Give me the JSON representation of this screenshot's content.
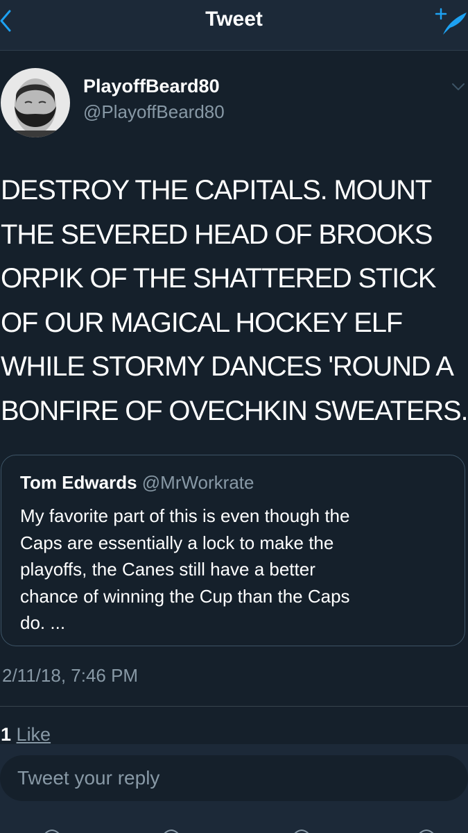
{
  "nav": {
    "title": "Tweet",
    "back_icon": "chevron-left-icon",
    "compose_icon": "compose-tweet-icon",
    "accent_color": "#1da1f2"
  },
  "author": {
    "name": "PlayoffBeard80",
    "handle": "@PlayoffBeard80",
    "avatar": "bearded-man-avatar",
    "menu_icon": "chevron-down-icon"
  },
  "tweet": {
    "lines": [
      "DESTROY THE CAPITALS. MOUNT",
      "THE SEVERED HEAD OF BROOKS",
      "ORPIK OF THE SHATTERED STICK",
      "OF OUR MAGICAL HOCKEY ELF",
      "WHILE STORMY DANCES 'ROUND A",
      "BONFIRE OF OVECHKIN SWEATERS."
    ]
  },
  "quoted": {
    "name": "Tom Edwards",
    "handle": "@MrWorkrate",
    "lines": [
      "My favorite part of this is even though the",
      "Caps are essentially a lock to make the",
      "playoffs, the Canes still have a better",
      "chance of winning the Cup than the Caps",
      "do. ..."
    ]
  },
  "meta": {
    "timestamp": "2/11/18, 7:46 PM",
    "likes_count": "1",
    "likes_label": "Like"
  },
  "reply": {
    "placeholder": "Tweet your reply"
  },
  "colors": {
    "background": "#15202b",
    "bar": "#1c2938",
    "secondary_text": "#8899a6",
    "border": "#3d5466"
  }
}
